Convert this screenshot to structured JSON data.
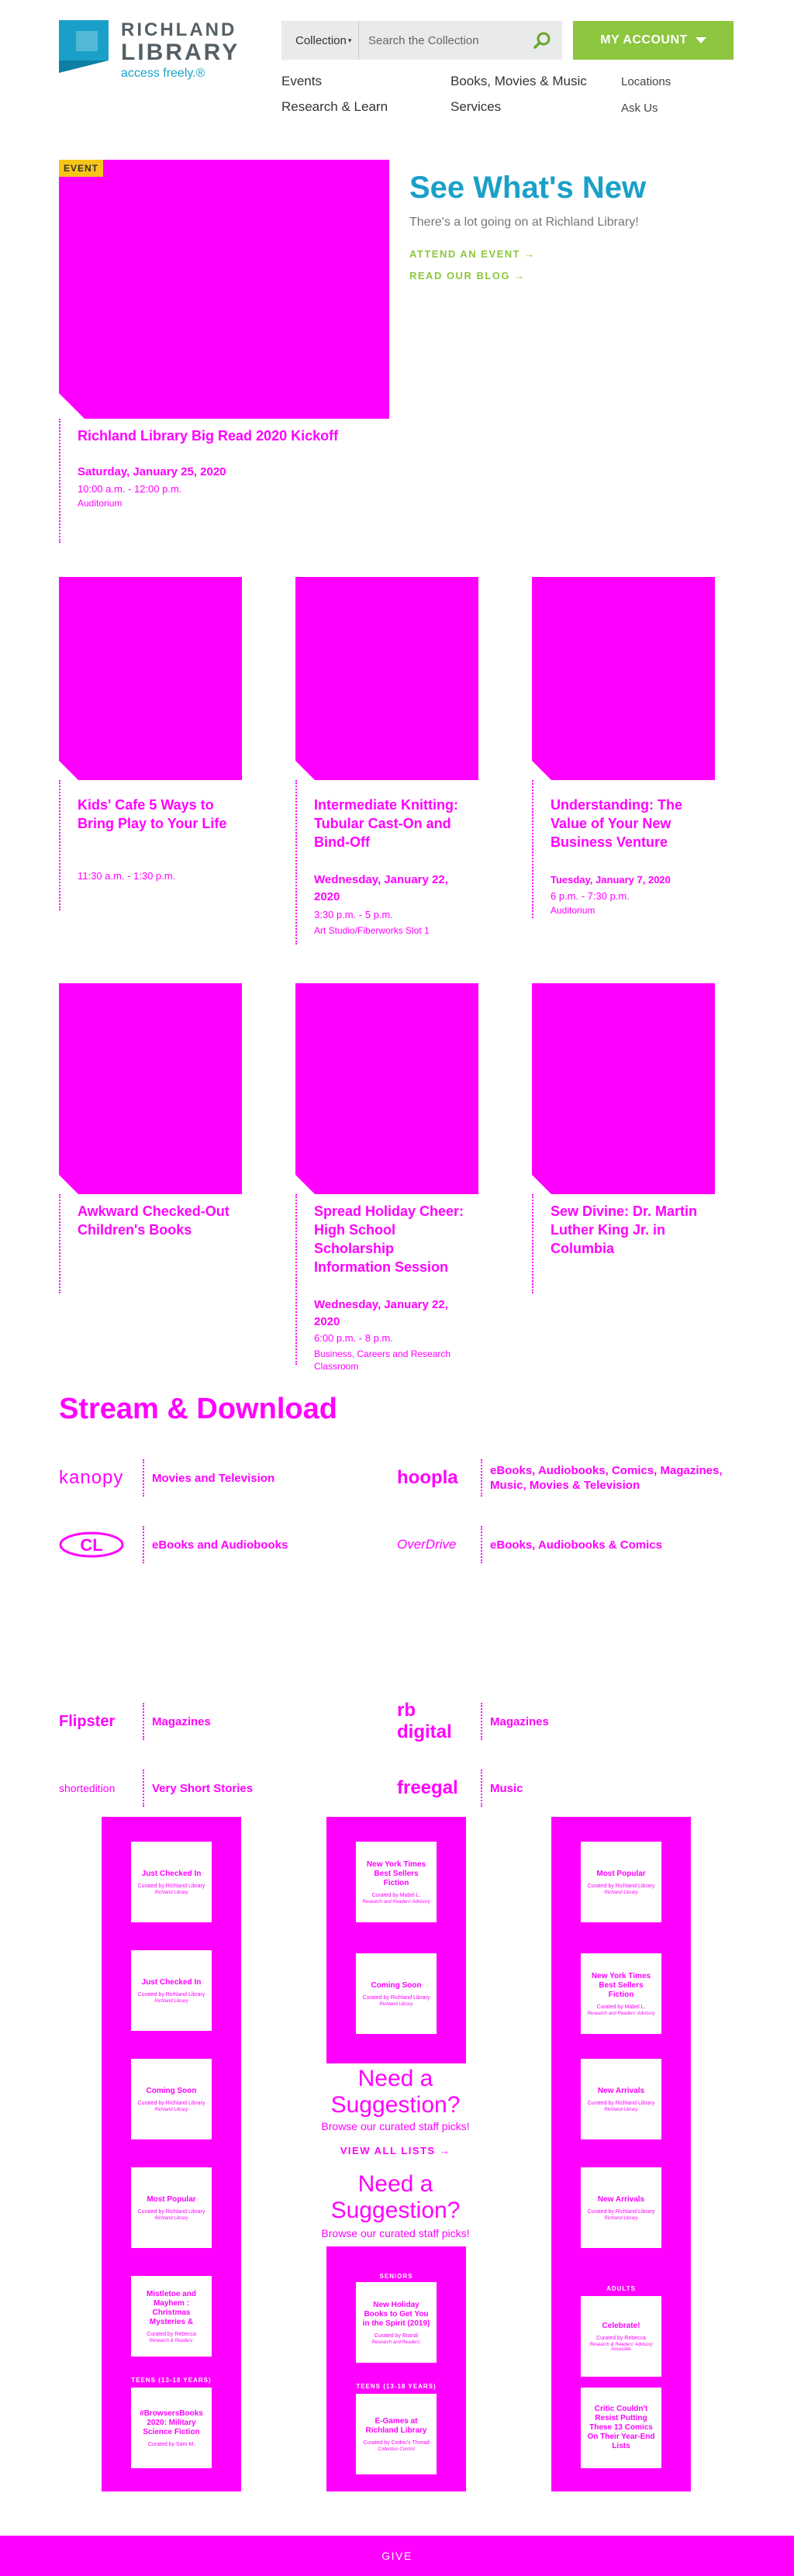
{
  "brand": {
    "name_line1": "RICHLAND",
    "name_line2": "LIBRARY",
    "tagline": "access freely.®",
    "colors": {
      "teal": "#1aa0c8",
      "green": "#8dc63f",
      "gray": "#555f66",
      "accent": "#ff00ff"
    }
  },
  "search": {
    "scope": "Collection",
    "placeholder": "Search the Collection",
    "button_icon": "search-icon"
  },
  "account": {
    "label": "MY ACCOUNT"
  },
  "nav": {
    "primary": [
      "Events",
      "Books, Movies & Music",
      "Research & Learn",
      "Services"
    ],
    "secondary": [
      "Locations",
      "Ask Us"
    ]
  },
  "hero": {
    "badge": "EVENT",
    "title": "Richland Library Big Read 2020 Kickoff",
    "date": "Saturday, January 25, 2020",
    "time": "10:00 a.m. - 12:00 p.m.",
    "location": "Auditorium",
    "heading": "See What's New",
    "subheading": "There's a lot going on at Richland Library!",
    "link_events": "ATTEND AN EVENT →",
    "link_blog": "READ OUR BLOG →"
  },
  "events": [
    {
      "title": "Kids' Cafe 5 Ways to Bring Play to Your Life",
      "date": "",
      "time": "11:30 a.m. - 1:30 p.m.",
      "location": ""
    },
    {
      "title": "Intermediate Knitting: Tubular Cast-On and Bind-Off",
      "date": "Wednesday, January 22, 2020",
      "time": "3:30 p.m. - 5 p.m.",
      "location": "Art Studio/Fiberworks Slot 1"
    },
    {
      "title": "Understanding: The Value of Your New Business Venture",
      "date": "Tuesday, January 7, 2020",
      "time": "6 p.m. - 7:30 p.m.",
      "location": "Auditorium"
    },
    {
      "title": "Awkward Checked-Out Children's Books",
      "date": "",
      "time": "",
      "location": ""
    },
    {
      "title": "Spread Holiday Cheer: High School Scholarship Information Session",
      "date": "Wednesday, January 22, 2020",
      "time": "6:00 p.m. - 8 p.m.",
      "location": "Business, Careers and Research Classroom"
    },
    {
      "title": "Sew Divine: Dr. Martin Luther King Jr. in Columbia",
      "date": "",
      "time": "",
      "location": ""
    }
  ],
  "stream": {
    "title": "Stream & Download",
    "services": [
      {
        "logo": "kanopy",
        "label": "Movies and Television"
      },
      {
        "logo": "hoopla",
        "label": "eBooks, Audiobooks, Comics, Magazines, Music, Movies & Television"
      },
      {
        "logo": "CL",
        "label": "eBooks and Audiobooks"
      },
      {
        "logo": "OverDrive",
        "label": "eBooks, Audiobooks & Comics"
      },
      {
        "logo": "Flipster",
        "label": "Magazines"
      },
      {
        "logo": "rb digital",
        "label": "Magazines"
      },
      {
        "logo": "shortedition",
        "label": "Very Short Stories"
      },
      {
        "logo": "freegal",
        "label": "Music"
      }
    ]
  },
  "staff_lists": {
    "left": [
      {
        "title": "Just Checked In",
        "by": "Curated by Richland Library",
        "org": "Richland Library"
      },
      {
        "title": "Just Checked In",
        "by": "Curated by Richland Library",
        "org": "Richland Library"
      },
      {
        "title": "Coming Soon",
        "by": "Curated by Richland Library",
        "org": "Richland Library"
      },
      {
        "title": "Most Popular",
        "by": "Curated by Richland Library",
        "org": "Richland Library"
      },
      {
        "title": "Mistletoe and Mayhem : Christmas Mysteries &",
        "by": "Curated by Rebecca",
        "org": "Research & Readers'"
      },
      {
        "title": "#BrowsersBooks 2020: Military Science Fiction",
        "by": "Curated by Sam M.",
        "org": "",
        "tag": "TEENS (13-18 YEARS)"
      }
    ],
    "middle_top": [
      {
        "title": "New York Times Best Sellers Fiction",
        "by": "Curated by Mabel L.",
        "org": "Research and Readers' Advisory"
      },
      {
        "title": "Coming Soon",
        "by": "Curated by Richland Library",
        "org": "Richland Library"
      }
    ],
    "middle_bottom": [
      {
        "title": "New Holiday Books to Get You in the Spirit (2019)",
        "by": "Curated by Brandi",
        "org": "Research and Readers'",
        "tag": "SENIORS"
      },
      {
        "title": "E-Games at Richland Library",
        "by": "Curated by Cedric's Thread",
        "org": "Collection Control",
        "tag": "TEENS (13-18 YEARS)"
      }
    ],
    "right": [
      {
        "title": "Most Popular",
        "by": "Curated by Richland Library",
        "org": "Richland Library"
      },
      {
        "title": "New York Times Best Sellers Fiction",
        "by": "Curated by Mabel L.",
        "org": "Research and Readers' Advisory"
      },
      {
        "title": "New Arrivals",
        "by": "Curated by Richland Library",
        "org": "Richland Library"
      },
      {
        "title": "New Arrivals",
        "by": "Curated by Richland Library",
        "org": "Richland Library"
      },
      {
        "title": "Celebrate!",
        "by": "Curated by Rebecca",
        "org": "Research & Readers' Advisory Associate",
        "tag": "ADULTS"
      },
      {
        "title": "Critic Couldn't Resist Putting These 13 Comics On Their Year-End Lists",
        "by": "",
        "org": ""
      }
    ],
    "heading": "Need a Suggestion?",
    "subheading": "Browse our curated staff picks!",
    "link": "VIEW ALL LISTS →"
  },
  "footer": {
    "give": "GIVE"
  }
}
